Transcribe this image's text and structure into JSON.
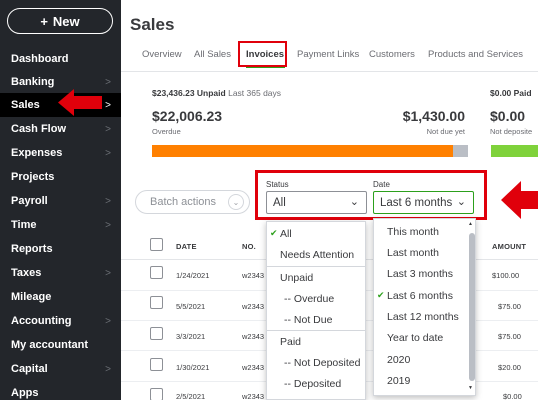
{
  "sidebar": {
    "new_label": "New",
    "new_icon": "plus",
    "items": [
      {
        "label": "Dashboard",
        "chevron": false
      },
      {
        "label": "Banking",
        "chevron": true
      },
      {
        "label": "Sales",
        "chevron": true,
        "active": true
      },
      {
        "label": "Cash Flow",
        "chevron": true
      },
      {
        "label": "Expenses",
        "chevron": true
      },
      {
        "label": "Projects",
        "chevron": false
      },
      {
        "label": "Payroll",
        "chevron": true
      },
      {
        "label": "Time",
        "chevron": true
      },
      {
        "label": "Reports",
        "chevron": false
      },
      {
        "label": "Taxes",
        "chevron": true
      },
      {
        "label": "Mileage",
        "chevron": false
      },
      {
        "label": "Accounting",
        "chevron": true
      },
      {
        "label": "My accountant",
        "chevron": false
      },
      {
        "label": "Capital",
        "chevron": true
      },
      {
        "label": "Apps",
        "chevron": false
      }
    ]
  },
  "page": {
    "title": "Sales"
  },
  "tabs": [
    "Overview",
    "All Sales",
    "Invoices",
    "Payment Links",
    "Customers",
    "Products and Services"
  ],
  "active_tab": "Invoices",
  "summary": {
    "unpaid_amount": "$23,436.23 Unpaid",
    "unpaid_period": "Last 365 days",
    "paid_amount": "$0.00 Paid",
    "overdue_value": "$22,006.23",
    "overdue_label": "Overdue",
    "notdue_value": "$1,430.00",
    "notdue_label": "Not due yet",
    "deposited_value": "$0.00",
    "deposited_label": "Not deposite",
    "overdue_fraction": 0.95
  },
  "batch_actions": "Batch actions",
  "filters": {
    "status_label": "Status",
    "status_value": "All",
    "date_label": "Date",
    "date_value": "Last 6 months"
  },
  "table": {
    "headers": {
      "date": "DATE",
      "no": "NO.",
      "amount": "AMOUNT"
    },
    "rows": [
      {
        "date": "1/24/2021",
        "no": "w2343",
        "amount": "$100.00"
      },
      {
        "date": "5/5/2021",
        "no": "w2343",
        "amount": "$75.00"
      },
      {
        "date": "3/3/2021",
        "no": "w2343",
        "amount": "$75.00"
      },
      {
        "date": "1/30/2021",
        "no": "w2343",
        "amount": "$20.00"
      },
      {
        "date": "2/5/2021",
        "no": "w2343",
        "amount": "$0.00"
      }
    ]
  },
  "status_menu": {
    "items": [
      {
        "label": "All",
        "checked": true,
        "child": false
      },
      {
        "label": "Needs Attention",
        "child": false
      },
      {
        "label": "Unpaid",
        "child": false
      },
      {
        "label": "-- Overdue",
        "child": true
      },
      {
        "label": "-- Not Due",
        "child": true
      },
      {
        "label": "Paid",
        "child": false
      },
      {
        "label": "-- Not Deposited",
        "child": true
      },
      {
        "label": "-- Deposited",
        "child": true
      }
    ]
  },
  "date_menu": {
    "items": [
      {
        "label": "This month"
      },
      {
        "label": "Last month"
      },
      {
        "label": "Last 3 months"
      },
      {
        "label": "Last 6 months",
        "checked": true
      },
      {
        "label": "Last 12 months"
      },
      {
        "label": "Year to date"
      },
      {
        "label": "2020"
      },
      {
        "label": "2019"
      }
    ]
  },
  "colors": {
    "highlight": "#e0000b",
    "accent": "#2ca01c",
    "sidebar": "#23262b",
    "overdue_bar": "#ff8000",
    "deposit_bar": "#7fd23b"
  }
}
